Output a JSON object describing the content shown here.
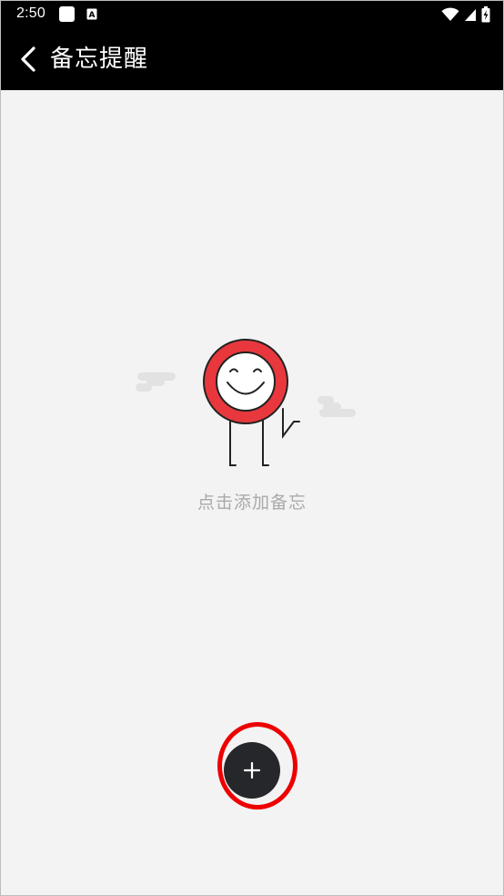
{
  "status_bar": {
    "time": "2:50",
    "notification_icons": [
      "app-square-icon",
      "translate-a-icon"
    ],
    "system_icons": [
      "wifi-icon",
      "cellular-signal-icon",
      "battery-charging-icon"
    ],
    "notif_a_letter": "A"
  },
  "app_bar": {
    "title": "备忘提醒",
    "back_icon": "chevron-left-icon",
    "background": "#000000"
  },
  "empty_state": {
    "illustration": "smiley-character-icon",
    "hint": "点击添加备忘",
    "accent": "#e8383d",
    "cloud_color": "#e2e2e2"
  },
  "fab": {
    "icon": "plus-icon",
    "symbol": "+",
    "color": "#26272b",
    "highlight_color": "#ee0000"
  }
}
